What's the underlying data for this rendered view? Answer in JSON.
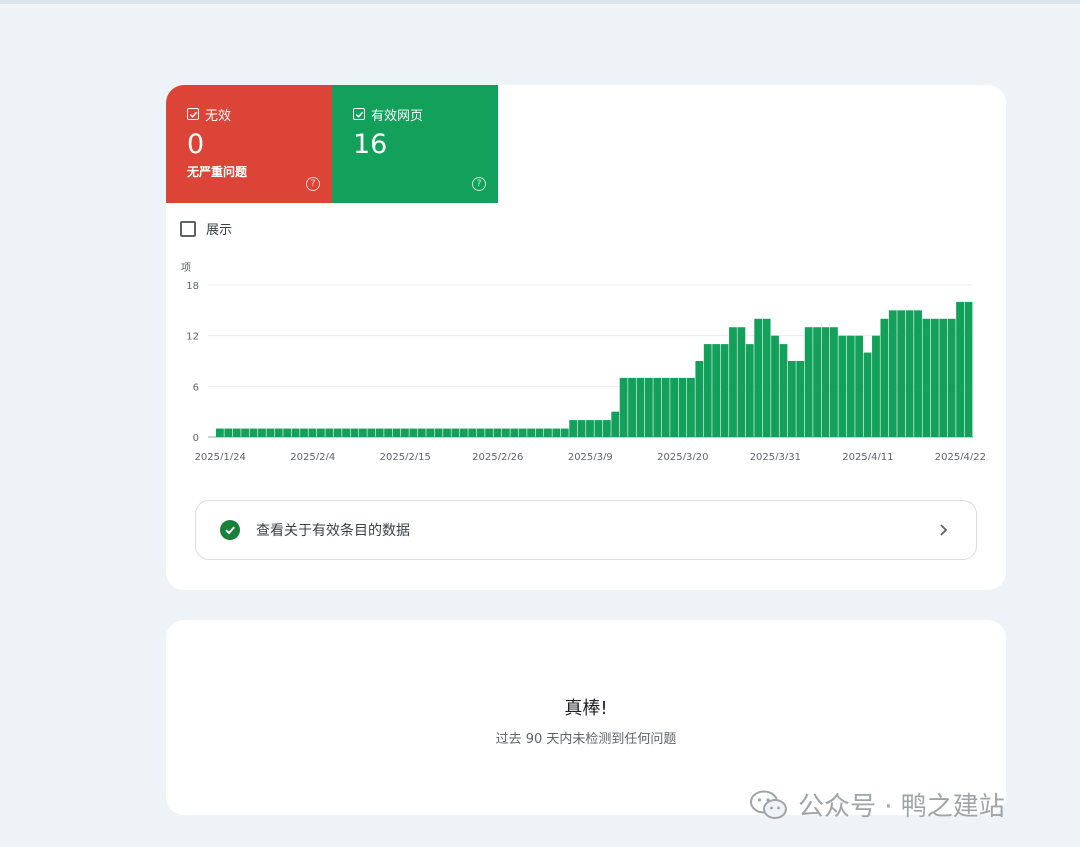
{
  "tiles": {
    "invalid": {
      "label": "无效",
      "count": "0",
      "subtitle": "无严重问题",
      "color": "#dc4437"
    },
    "valid": {
      "label": "有效网页",
      "count": "16",
      "color": "#12a05a"
    }
  },
  "display_toggle": {
    "label": "展示"
  },
  "chart_data": {
    "type": "bar",
    "ylabel": "项",
    "ylim": [
      0,
      18
    ],
    "yticks": [
      0,
      6,
      12,
      18
    ],
    "x_tick_labels": [
      "2025/1/24",
      "2025/2/4",
      "2025/2/15",
      "2025/2/26",
      "2025/3/9",
      "2025/3/20",
      "2025/3/31",
      "2025/4/11",
      "2025/4/22"
    ],
    "x_tick_indices": [
      0,
      11,
      22,
      33,
      44,
      55,
      66,
      77,
      88
    ],
    "color": "#12a05a",
    "values": [
      1,
      1,
      1,
      1,
      1,
      1,
      1,
      1,
      1,
      1,
      1,
      1,
      1,
      1,
      1,
      1,
      1,
      1,
      1,
      1,
      1,
      1,
      1,
      1,
      1,
      1,
      1,
      1,
      1,
      1,
      1,
      1,
      1,
      1,
      1,
      1,
      1,
      1,
      1,
      1,
      1,
      1,
      2,
      2,
      2,
      2,
      2,
      3,
      7,
      7,
      7,
      7,
      7,
      7,
      7,
      7,
      7,
      9,
      11,
      11,
      11,
      13,
      13,
      11,
      14,
      14,
      12,
      11,
      9,
      9,
      13,
      13,
      13,
      13,
      12,
      12,
      12,
      10,
      12,
      14,
      15,
      15,
      15,
      15,
      14,
      14,
      14,
      14,
      16,
      16
    ]
  },
  "link_row": {
    "label": "查看关于有效条目的数据"
  },
  "summary": {
    "title": "真棒!",
    "text": "过去 90 天内未检测到任何问题"
  },
  "watermark": {
    "text": "公众号 · 鸭之建站"
  }
}
